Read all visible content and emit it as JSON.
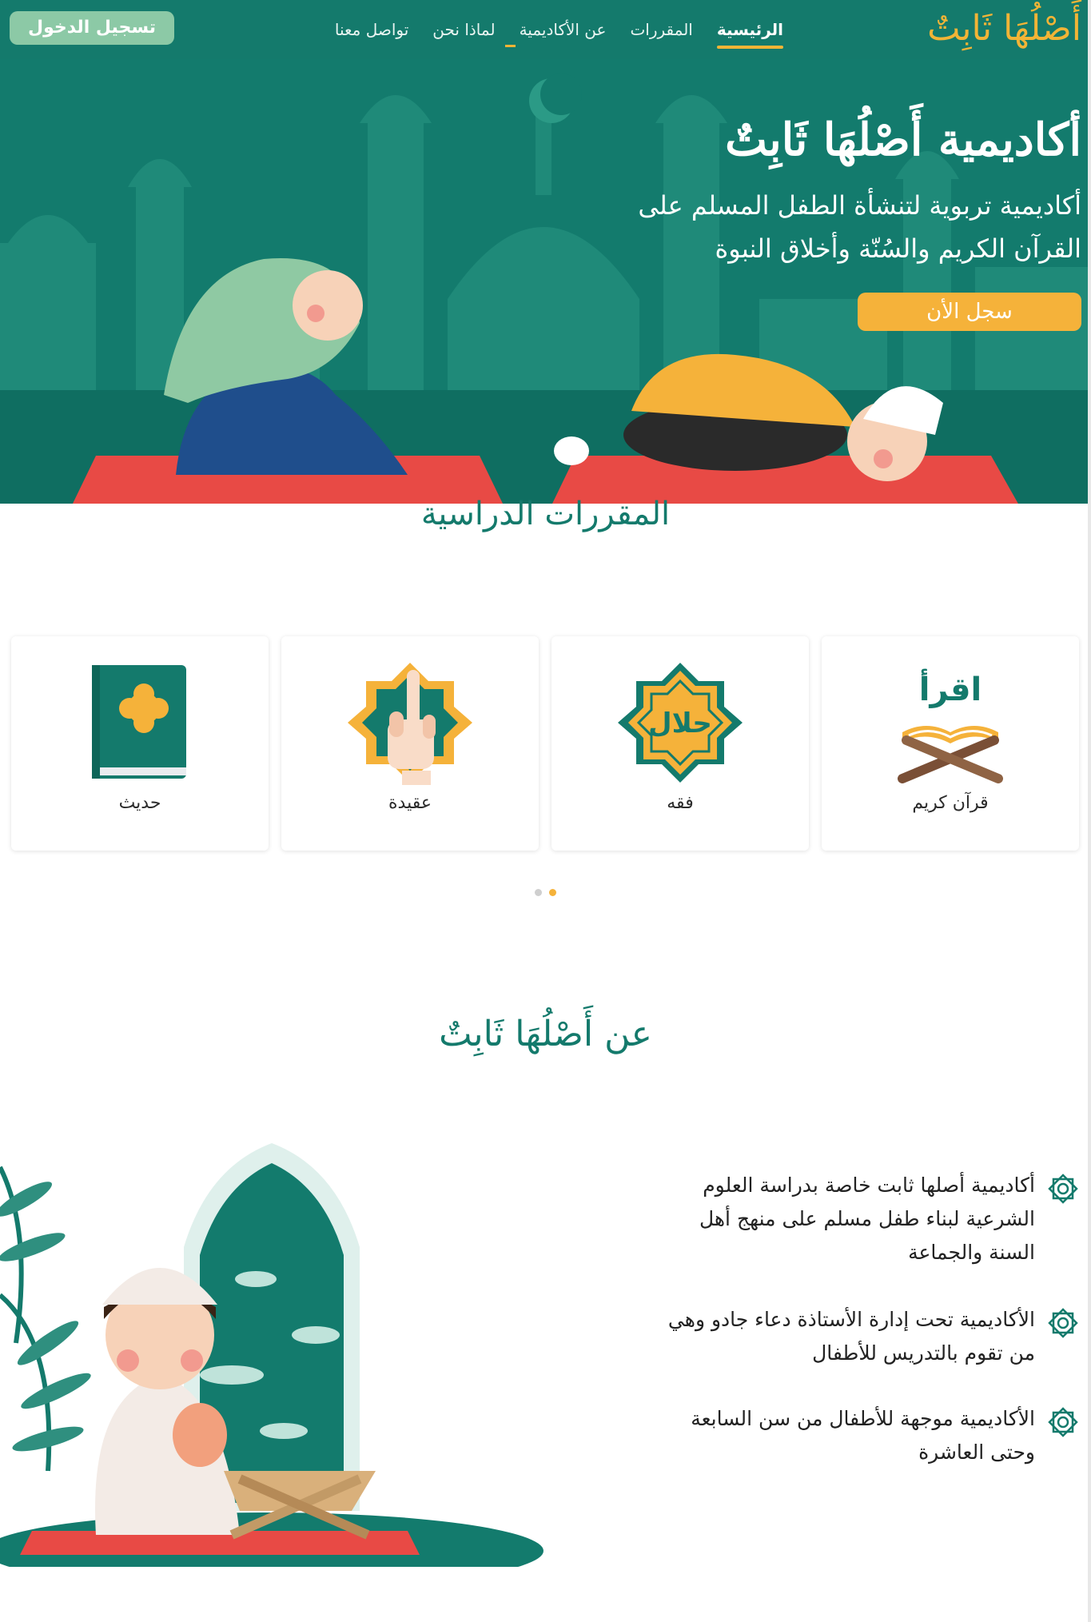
{
  "header": {
    "logo": "أَصْلُهَا ثَابِتٌ",
    "nav": [
      {
        "label": "الرئيسية",
        "active": true
      },
      {
        "label": "المقررات",
        "active": false
      },
      {
        "label": "عن الأكاديمية",
        "active": false
      },
      {
        "label": "لماذا نحن",
        "active": false
      },
      {
        "label": "تواصل معنا",
        "active": false
      }
    ],
    "login_label": "تسجيل الدخول"
  },
  "hero": {
    "title": "أكاديمية أَصْلُهَا ثَابِتٌ",
    "subtitle_line1": "أكاديمية تربوية لتنشأة الطفل المسلم على",
    "subtitle_line2": "القرآن الكريم والسُنّة وأخلاق النبوة",
    "cta_label": "سجل الأن"
  },
  "courses": {
    "title": "المقررات الدراسية",
    "items": [
      {
        "label": "قرآن كريم",
        "icon": "quran-stand-icon"
      },
      {
        "label": "فقه",
        "icon": "halal-star-icon"
      },
      {
        "label": "عقيدة",
        "icon": "tawhid-hand-icon"
      },
      {
        "label": "حديث",
        "icon": "hadith-book-icon"
      }
    ],
    "carousel": {
      "pages": 2,
      "active_page": 2
    }
  },
  "about": {
    "title": "عن أَصْلُهَا ثَابِتٌ",
    "items": [
      {
        "text": "أكاديمية أصلها ثابت خاصة بدراسة العلوم الشرعية لبناء طفل مسلم على منهج أهل السنة والجماعة"
      },
      {
        "text": "الأكاديمية تحت إدارة الأستاذة دعاء جادو وهي من تقوم بالتدريس للأطفال"
      },
      {
        "text": "الأكاديمية موجهة للأطفال من سن السابعة وحتى العاشرة"
      }
    ]
  },
  "colors": {
    "primary": "#147a6c",
    "accent": "#f2b436",
    "login_button": "#8cc9a6"
  }
}
